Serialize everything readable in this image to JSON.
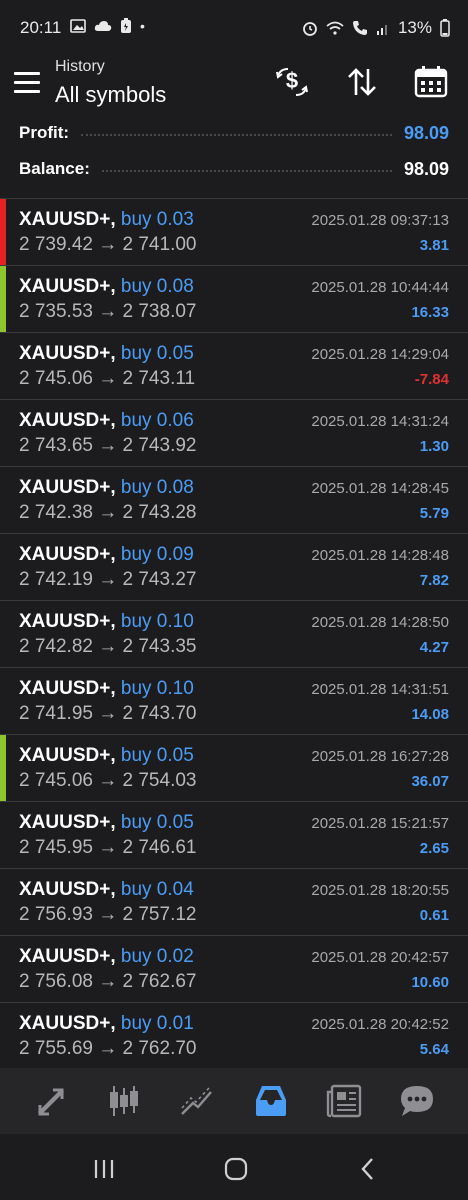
{
  "status_bar": {
    "time": "20:11",
    "battery": "13%"
  },
  "header": {
    "subtitle": "History",
    "title": "All symbols"
  },
  "summary": {
    "profit_label": "Profit:",
    "profit_value": "98.09",
    "balance_label": "Balance:",
    "balance_value": "98.09"
  },
  "colors": {
    "accent": "#4a9cf5",
    "profit_positive": "#4a9cf5",
    "loss": "#e03030",
    "stripe_red": "#e52121",
    "stripe_green": "#8cc62c",
    "background": "#1c1c1e"
  },
  "trades": [
    {
      "symbol": "XAUUSD+,",
      "side": "buy 0.03",
      "prices": "2 739.42 → 2 741.00",
      "time": "2025.01.28 09:37:13",
      "profit": "3.81",
      "stripe": "red"
    },
    {
      "symbol": "XAUUSD+,",
      "side": "buy 0.08",
      "prices": "2 735.53 → 2 738.07",
      "time": "2025.01.28 10:44:44",
      "profit": "16.33",
      "stripe": "green"
    },
    {
      "symbol": "XAUUSD+,",
      "side": "buy 0.05",
      "prices": "2 745.06 → 2 743.11",
      "time": "2025.01.28 14:29:04",
      "profit": "-7.84",
      "stripe": "none"
    },
    {
      "symbol": "XAUUSD+,",
      "side": "buy 0.06",
      "prices": "2 743.65 → 2 743.92",
      "time": "2025.01.28 14:31:24",
      "profit": "1.30",
      "stripe": "none"
    },
    {
      "symbol": "XAUUSD+,",
      "side": "buy 0.08",
      "prices": "2 742.38 → 2 743.28",
      "time": "2025.01.28 14:28:45",
      "profit": "5.79",
      "stripe": "none"
    },
    {
      "symbol": "XAUUSD+,",
      "side": "buy 0.09",
      "prices": "2 742.19 → 2 743.27",
      "time": "2025.01.28 14:28:48",
      "profit": "7.82",
      "stripe": "none"
    },
    {
      "symbol": "XAUUSD+,",
      "side": "buy 0.10",
      "prices": "2 742.82 → 2 743.35",
      "time": "2025.01.28 14:28:50",
      "profit": "4.27",
      "stripe": "none"
    },
    {
      "symbol": "XAUUSD+,",
      "side": "buy 0.10",
      "prices": "2 741.95 → 2 743.70",
      "time": "2025.01.28 14:31:51",
      "profit": "14.08",
      "stripe": "none"
    },
    {
      "symbol": "XAUUSD+,",
      "side": "buy 0.05",
      "prices": "2 745.06 → 2 754.03",
      "time": "2025.01.28 16:27:28",
      "profit": "36.07",
      "stripe": "green"
    },
    {
      "symbol": "XAUUSD+,",
      "side": "buy 0.05",
      "prices": "2 745.95 → 2 746.61",
      "time": "2025.01.28 15:21:57",
      "profit": "2.65",
      "stripe": "none"
    },
    {
      "symbol": "XAUUSD+,",
      "side": "buy 0.04",
      "prices": "2 756.93 → 2 757.12",
      "time": "2025.01.28 18:20:55",
      "profit": "0.61",
      "stripe": "none"
    },
    {
      "symbol": "XAUUSD+,",
      "side": "buy 0.02",
      "prices": "2 756.08 → 2 762.67",
      "time": "2025.01.28 20:42:57",
      "profit": "10.60",
      "stripe": "none"
    },
    {
      "symbol": "XAUUSD+,",
      "side": "buy 0.01",
      "prices": "2 755.69 → 2 762.70",
      "time": "2025.01.28 20:42:52",
      "profit": "5.64",
      "stripe": "none"
    }
  ],
  "bottom_nav": [
    {
      "icon": "quotes-icon",
      "active": false
    },
    {
      "icon": "chart-icon",
      "active": false
    },
    {
      "icon": "trade-icon",
      "active": false
    },
    {
      "icon": "history-icon",
      "active": true
    },
    {
      "icon": "news-icon",
      "active": false
    },
    {
      "icon": "messages-icon",
      "active": false
    }
  ],
  "system_nav": [
    "recent-apps-icon",
    "home-icon",
    "back-icon"
  ]
}
